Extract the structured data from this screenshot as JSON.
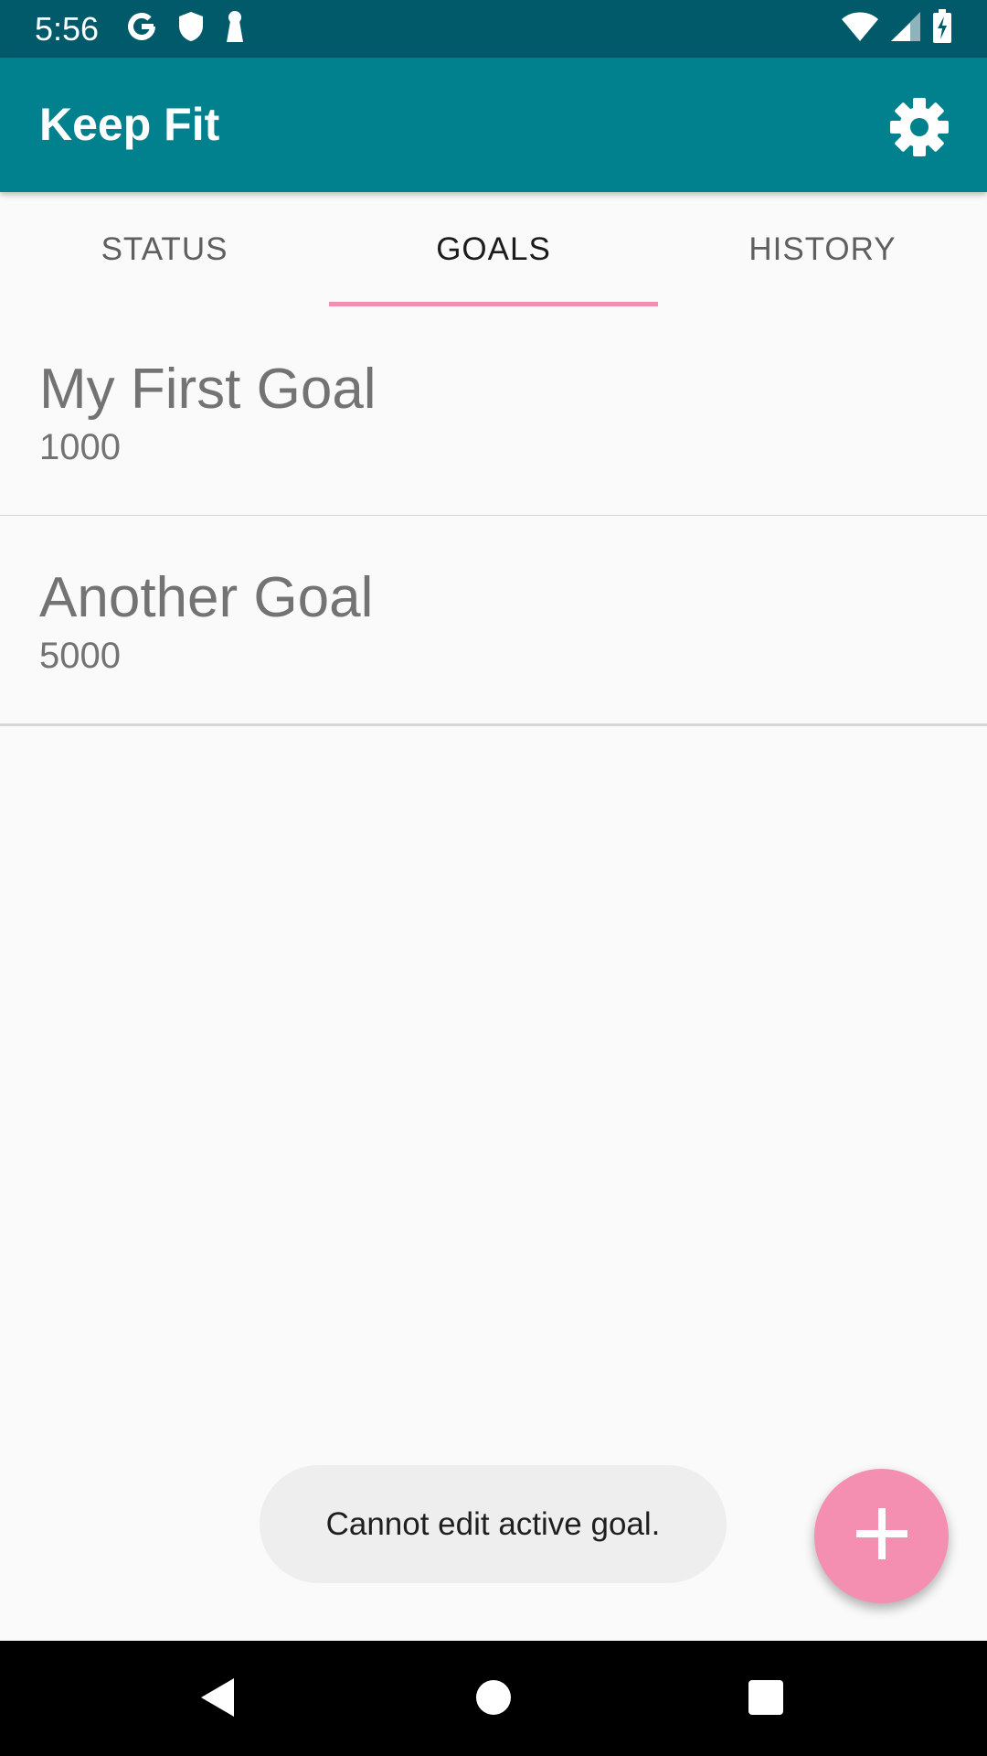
{
  "status_bar": {
    "time": "5:56",
    "left_icons": [
      "google-icon",
      "shield-icon",
      "keyhole-icon"
    ],
    "right_icons": [
      "wifi-icon",
      "cell-signal-icon",
      "battery-charging-icon"
    ]
  },
  "app_bar": {
    "title": "Keep Fit",
    "settings_icon": "gear-icon"
  },
  "tabs": [
    {
      "label": "STATUS",
      "active": false
    },
    {
      "label": "GOALS",
      "active": true
    },
    {
      "label": "HISTORY",
      "active": false
    }
  ],
  "goals": [
    {
      "name": "My First Goal",
      "value": "1000"
    },
    {
      "name": "Another Goal",
      "value": "5000"
    }
  ],
  "toast": {
    "message": "Cannot edit active goal."
  },
  "fab": {
    "icon": "plus-icon"
  },
  "nav_bar": {
    "icons": [
      "back-icon",
      "home-icon",
      "recents-icon"
    ]
  },
  "colors": {
    "status_bar": "#005a6a",
    "app_bar": "#00818d",
    "accent": "#f48fb1",
    "background": "#fafafa"
  }
}
